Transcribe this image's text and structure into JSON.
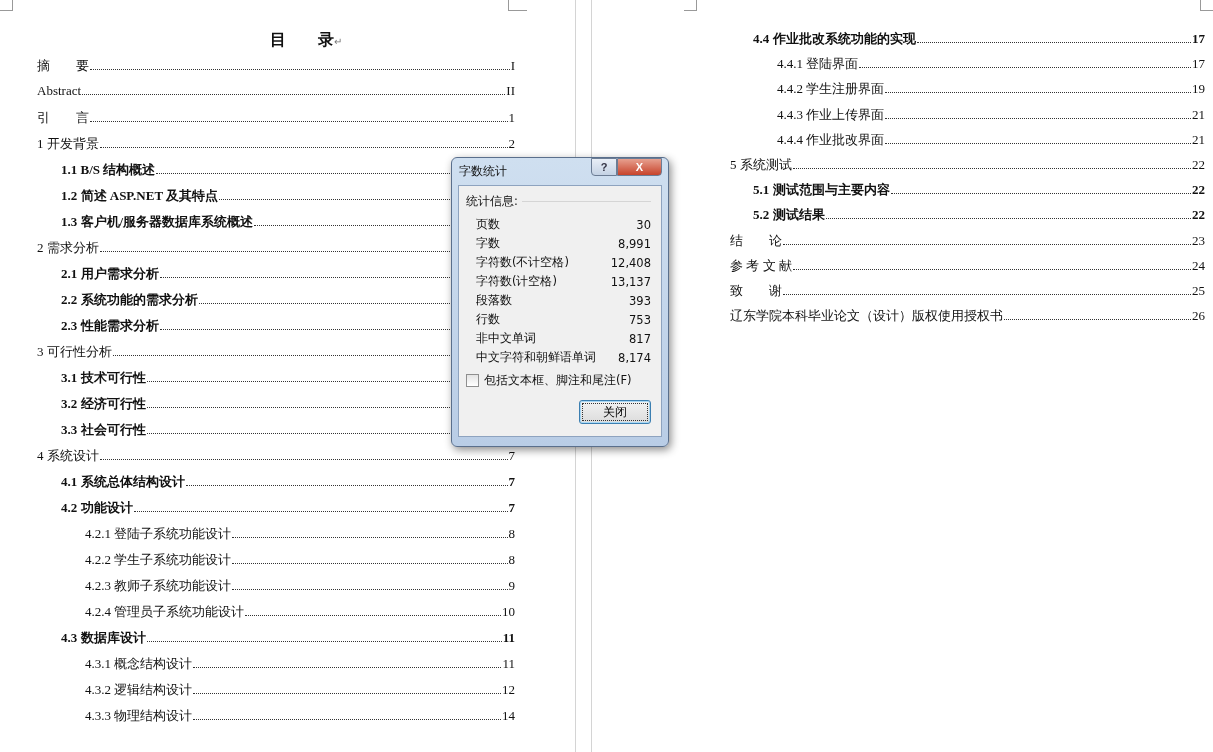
{
  "left_page": {
    "title": "目　　录",
    "title_mark": "↵",
    "entries": [
      {
        "text": "摘　　要",
        "page": "I"
      },
      {
        "text": "Abstract",
        "page": "II"
      },
      {
        "text": "引　　言",
        "page": "1"
      },
      {
        "text": "1 开发背景",
        "page": "2",
        "children": [
          {
            "text": "1.1 B/S 结构概述"
          },
          {
            "text": "1.2 简述 ASP.NET 及其特点"
          },
          {
            "text": "1.3 客户机/服务器数据库系统概述"
          }
        ]
      },
      {
        "text": "2 需求分析",
        "children": [
          {
            "text": "2.1  用户需求分析"
          },
          {
            "text": "2.2  系统功能的需求分析"
          },
          {
            "text": "2.3  性能需求分析"
          }
        ]
      },
      {
        "text": "3 可行性分析",
        "children": [
          {
            "text": "3.1  技术可行性"
          },
          {
            "text": "3.2  经济可行性"
          },
          {
            "text": "3.3  社会可行性"
          }
        ]
      },
      {
        "text": "4 系统设计",
        "page": "7",
        "children": [
          {
            "text": "4.1 系统总体结构设计",
            "page": "7"
          },
          {
            "text": "4.2 功能设计",
            "page": "7",
            "children": [
              {
                "text": "4.2.1 登陆子系统功能设计",
                "page": "8"
              },
              {
                "text": "4.2.2 学生子系统功能设计",
                "page": "8"
              },
              {
                "text": "4.2.3 教师子系统功能设计",
                "page": "9"
              },
              {
                "text": "4.2.4 管理员子系统功能设计",
                "page": "10"
              }
            ]
          },
          {
            "text": "4.3 数据库设计",
            "page": "11",
            "children": [
              {
                "text": "4.3.1  概念结构设计",
                "page": "11"
              },
              {
                "text": "4.3.2 逻辑结构设计",
                "page": "12"
              },
              {
                "text": "4.3.3 物理结构设计",
                "page": "14"
              }
            ]
          }
        ]
      }
    ]
  },
  "right_page": {
    "continued": [
      {
        "text": "4.4 作业批改系统功能的实现",
        "page": "17",
        "children": [
          {
            "text": "4.4.1  登陆界面",
            "page": "17"
          },
          {
            "text": "4.4.2 学生注册界面",
            "page": "19"
          },
          {
            "text": "4.4.3 作业上传界面",
            "page": "21"
          },
          {
            "text": "4.4.4 作业批改界面",
            "page": "21"
          }
        ]
      }
    ],
    "entries": [
      {
        "text": "5 系统测试",
        "page": "22",
        "children": [
          {
            "text": "5.1 测试范围与主要内容",
            "page": "22"
          },
          {
            "text": "5.2 测试结果",
            "page": "22"
          }
        ]
      },
      {
        "text": "结　　论",
        "page": "23"
      },
      {
        "text": "参 考 文 献",
        "page": "24"
      },
      {
        "text": "致　　谢",
        "page": "25"
      },
      {
        "text": "辽东学院本科毕业论文（设计）版权使用授权书",
        "page": "26"
      }
    ]
  },
  "dialog": {
    "title": "字数统计",
    "help": "?",
    "close": "X",
    "group_label": "统计信息:",
    "stats": [
      {
        "label": "页数",
        "value": "30"
      },
      {
        "label": "字数",
        "value": "8,991"
      },
      {
        "label": "字符数(不计空格)",
        "value": "12,408"
      },
      {
        "label": "字符数(计空格)",
        "value": "13,137"
      },
      {
        "label": "段落数",
        "value": "393"
      },
      {
        "label": "行数",
        "value": "753"
      },
      {
        "label": "非中文单词",
        "value": "817"
      },
      {
        "label": "中文字符和朝鲜语单词",
        "value": "8,174"
      }
    ],
    "checkbox": {
      "label": "包括文本框、脚注和尾注(F)",
      "checked": false
    },
    "button": "关闭"
  }
}
